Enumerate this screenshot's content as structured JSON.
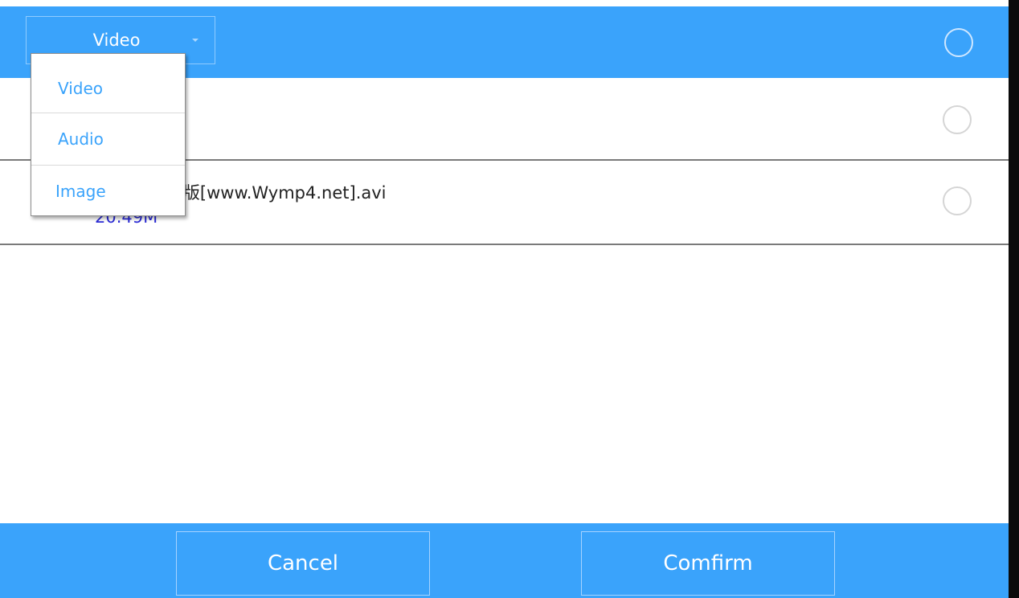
{
  "header": {
    "type_select": {
      "selected": "Video"
    }
  },
  "dropdown": {
    "options": [
      "Video",
      "Audio",
      "Image"
    ]
  },
  "files": [
    {
      "name": "",
      "size": ""
    },
    {
      "name": "Genie 热舞版[www.Wymp4.net].avi",
      "size": "20.49M"
    }
  ],
  "footer": {
    "cancel_label": "Cancel",
    "confirm_label": "Comfirm"
  },
  "colors": {
    "accent": "#3aa3fb",
    "size_text": "#2b2bd6"
  }
}
